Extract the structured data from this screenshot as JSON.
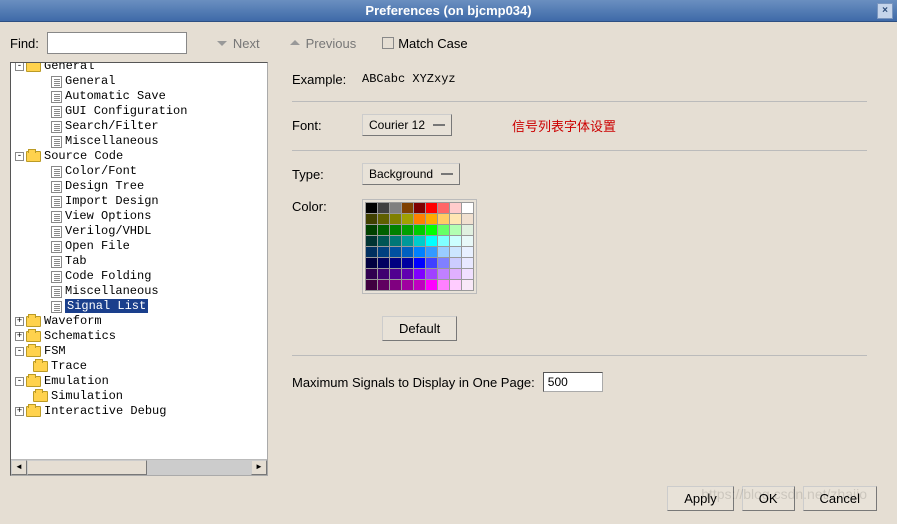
{
  "title": "Preferences (on bjcmp034)",
  "find": {
    "label": "Find:",
    "value": "",
    "next": "Next",
    "previous": "Previous",
    "match_case": "Match Case"
  },
  "tree": {
    "general": {
      "label": "General",
      "children": [
        "General",
        "Automatic Save",
        "GUI Configuration",
        "Search/Filter",
        "Miscellaneous"
      ]
    },
    "source": {
      "label": "Source Code",
      "children": [
        "Color/Font",
        "Design Tree",
        "Import Design",
        "View Options",
        "Verilog/VHDL",
        "Open File",
        "Tab",
        "Code Folding",
        "Miscellaneous",
        "Signal List"
      ]
    },
    "waveform": "Waveform",
    "schematics": "Schematics",
    "fsm": {
      "label": "FSM",
      "children": [
        "Trace"
      ]
    },
    "emulation": {
      "label": "Emulation",
      "children": [
        "Simulation"
      ]
    },
    "truncated": "Interactive Debug"
  },
  "selected": "Signal List",
  "settings": {
    "example_label": "Example:",
    "example_value": "ABCabc XYZxyz",
    "font_label": "Font:",
    "font_value": "Courier 12",
    "note": "信号列表字体设置",
    "type_label": "Type:",
    "type_value": "Background",
    "color_label": "Color:",
    "default_btn": "Default",
    "max_label": "Maximum Signals to Display in One Page:",
    "max_value": "500"
  },
  "palette": [
    [
      "#000000",
      "#404040",
      "#808080",
      "#804000",
      "#800000",
      "#ff0000",
      "#ff6666",
      "#ffcccc",
      "#ffffff"
    ],
    [
      "#404000",
      "#606000",
      "#808000",
      "#a0a000",
      "#ff8000",
      "#ffaa00",
      "#ffcc66",
      "#ffe6b3",
      "#f0e0d0"
    ],
    [
      "#004000",
      "#006000",
      "#008000",
      "#00a000",
      "#00cc00",
      "#00ff00",
      "#66ff66",
      "#b3ffb3",
      "#e0f0e0"
    ],
    [
      "#003333",
      "#005555",
      "#007777",
      "#009999",
      "#00cccc",
      "#00ffff",
      "#80ffff",
      "#ccffff",
      "#e8f8f8"
    ],
    [
      "#003060",
      "#004080",
      "#0050a0",
      "#0060c0",
      "#0080ff",
      "#3399ff",
      "#99ccff",
      "#cce6ff",
      "#e8f0ff"
    ],
    [
      "#000040",
      "#000060",
      "#000080",
      "#0000a0",
      "#0000ff",
      "#4040ff",
      "#8080ff",
      "#ccccff",
      "#e8e8ff"
    ],
    [
      "#300050",
      "#400070",
      "#500090",
      "#6000b0",
      "#8000ff",
      "#a040ff",
      "#c080ff",
      "#e0b0ff",
      "#f0e0ff"
    ],
    [
      "#400040",
      "#600060",
      "#800080",
      "#a000a0",
      "#c000c0",
      "#ff00ff",
      "#ff80ff",
      "#ffccff",
      "#f8e8f8"
    ]
  ],
  "footer": {
    "apply": "Apply",
    "ok": "OK",
    "cancel": "Cancel"
  },
  "watermark": "https://blog.csdn.net/zhajio"
}
